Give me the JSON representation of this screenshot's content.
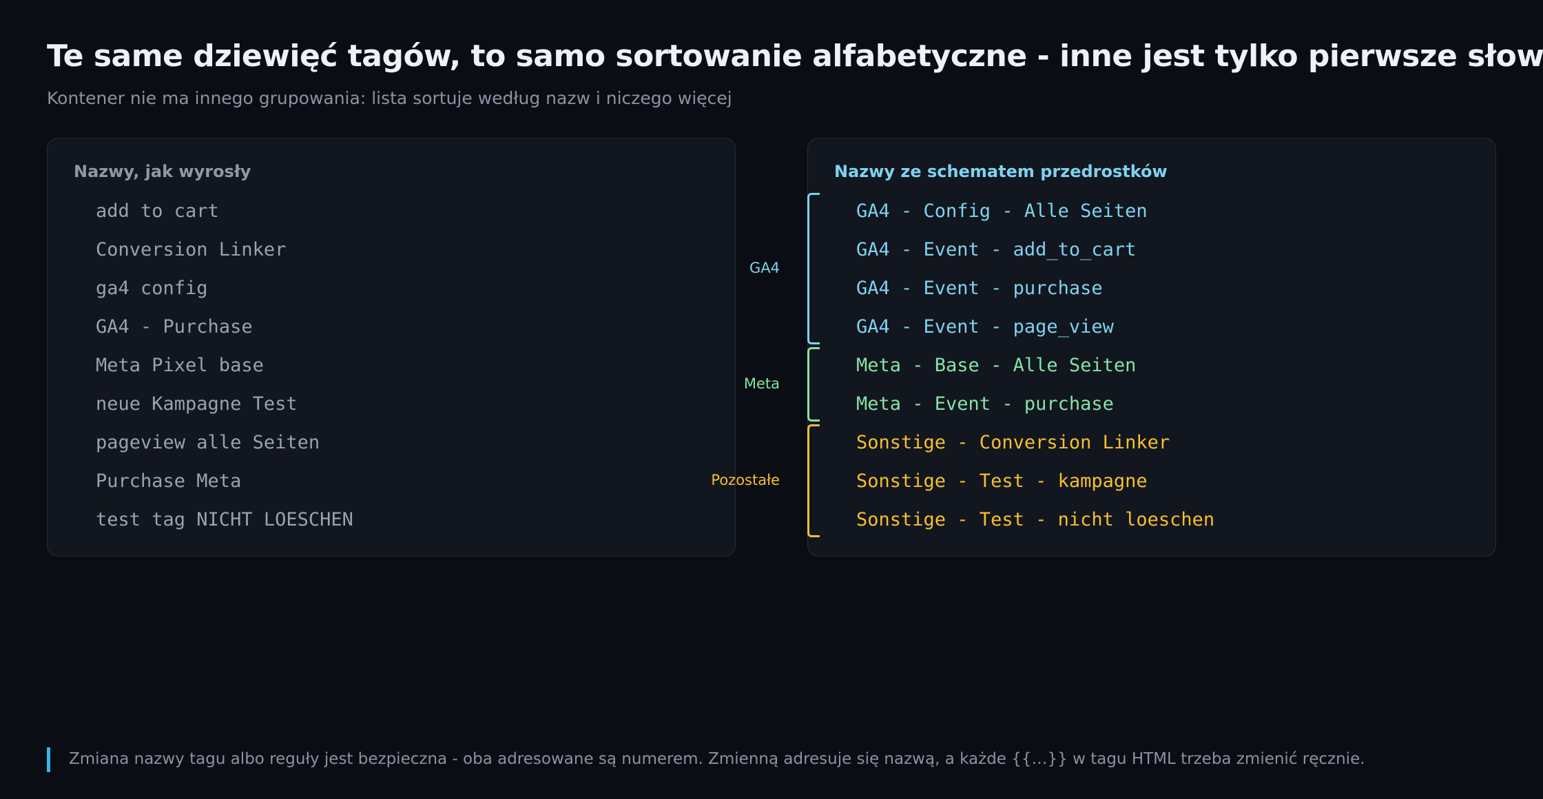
{
  "title": "Te same dziewięć tagów, to samo sortowanie alfabetyczne - inne jest tylko pierwsze słowo",
  "subtitle": "Kontener nie ma innego grupowania: lista sortuje według nazw i niczego więcej",
  "left_panel": {
    "title": "Nazwy, jak wyrosły",
    "items": [
      "add to cart",
      "Conversion Linker",
      "ga4 config",
      "GA4 - Purchase",
      "Meta Pixel base",
      "neue Kampagne Test",
      "pageview alle Seiten",
      "Purchase Meta",
      "test tag NICHT LOESCHEN"
    ]
  },
  "right_panel": {
    "title": "Nazwy ze schematem przedrostków",
    "items": [
      "GA4 - Config - Alle Seiten",
      "GA4 - Event - add_to_cart",
      "GA4 - Event - purchase",
      "GA4 - Event - page_view",
      "Meta - Base - Alle Seiten",
      "Meta - Event - purchase",
      "Sonstige - Conversion Linker",
      "Sonstige - Test - kampagne",
      "Sonstige - Test - nicht loeschen"
    ]
  },
  "groups": {
    "ga4": {
      "label": "GA4",
      "color": "#7dd3f0"
    },
    "meta": {
      "label": "Meta",
      "color": "#86e3a4"
    },
    "other": {
      "label": "Pozostałe",
      "color": "#f7bf2e"
    }
  },
  "footer": "Zmiana nazwy tagu albo reguły jest bezpieczna - oba adresowane są numerem. Zmienną adresuje się nazwą, a każde {{…}} w tagu HTML trzeba zmienić ręcznie."
}
